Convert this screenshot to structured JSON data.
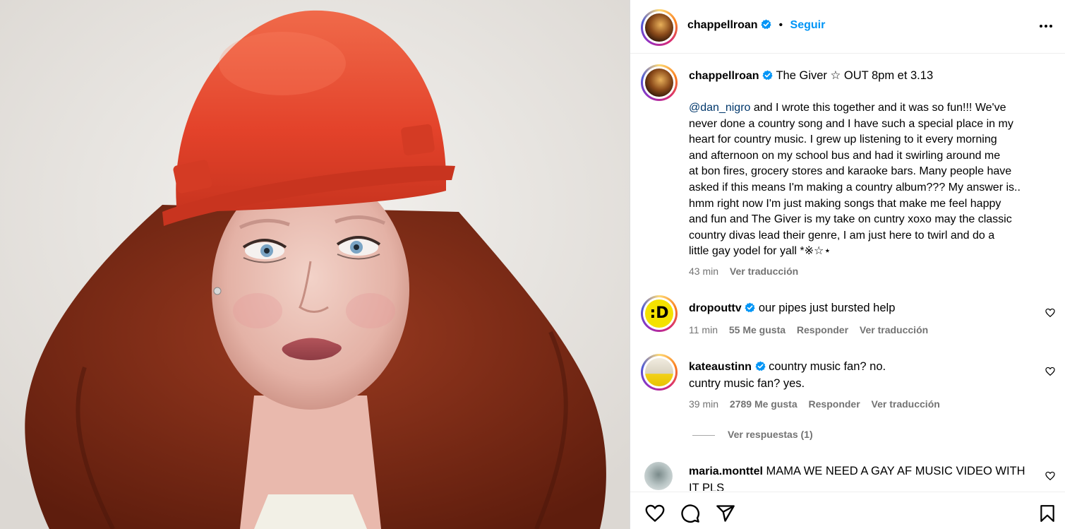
{
  "post": {
    "username": "chappellroan",
    "separator": "•",
    "follow_label": "Seguir",
    "more_label": "•••"
  },
  "caption": {
    "username": "chappellroan",
    "title": "The Giver ☆ OUT 8pm et 3.13",
    "mention": "@dan_nigro",
    "lines": [
      " and I wrote this together and it was so fun!!! We've",
      "never done a country song and I have such a special place in my",
      "heart for country music.  I grew up listening to it every morning",
      "and afternoon on my school bus and had it swirling around me",
      "at bon fires, grocery stores and karaoke bars. Many people have",
      "asked if this means I'm making a country album??? My answer is..",
      "hmm right now I'm just making songs that make me feel happy",
      "and fun and The Giver is my take on cuntry xoxo may the classic",
      "country divas lead their genre, I am just here to twirl and do a",
      "little gay yodel for yall *※☆⋆"
    ],
    "time": "43 min",
    "translate": "Ver traducción"
  },
  "comments": [
    {
      "username": "dropouttv",
      "avatar_letter": ":D",
      "lines": [
        "our pipes just bursted help"
      ],
      "time": "11 min",
      "likes": "55 Me gusta",
      "reply": "Responder",
      "translate": "Ver traducción"
    },
    {
      "username": "kateaustinn",
      "lines": [
        "country music fan? no.",
        "cuntry music fan? yes."
      ],
      "time": "39 min",
      "likes": "2789 Me gusta",
      "reply": "Responder",
      "translate": "Ver traducción",
      "replies_label": "Ver respuestas (1)"
    },
    {
      "username": "maria.monttel",
      "lines": [
        "MAMA WE NEED A GAY AF MUSIC VIDEO WITH",
        "IT PLS"
      ]
    }
  ],
  "icons": {
    "verified": "verified-badge-icon",
    "like": "heart-icon",
    "comment": "comment-bubble-icon",
    "share": "paper-plane-icon",
    "save": "bookmark-icon",
    "more": "more-options-icon"
  },
  "colors": {
    "accent": "#0095f6",
    "mention": "#00376b",
    "muted": "#737373",
    "verified": "#0095f6",
    "helmet": "#e8452a",
    "hair": "#7a2a16"
  }
}
